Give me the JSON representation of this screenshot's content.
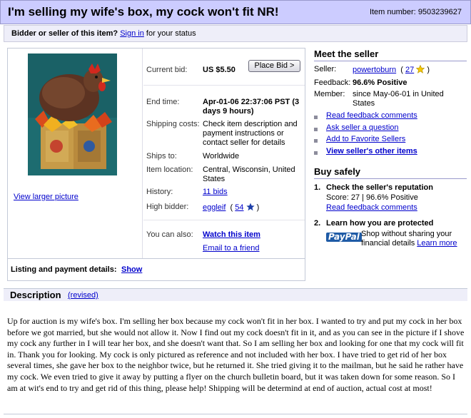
{
  "title": "I'm selling my wife's box, my cock won't fit NR!",
  "item_number_label": "Item number:",
  "item_number": "9503239627",
  "status": {
    "question": "Bidder or seller of this item?",
    "sign_in": "Sign in",
    "suffix": "for your status"
  },
  "view_larger": "View larger picture",
  "details": {
    "current_bid_label": "Current bid:",
    "current_bid": "US $5.50",
    "place_bid": "Place Bid >",
    "end_time_label": "End time:",
    "end_time": "Apr-01-06 22:37:06 PST (3 days 9 hours)",
    "shipping_label": "Shipping costs:",
    "shipping": "Check item description and payment instructions or contact seller for details",
    "ships_to_label": "Ships to:",
    "ships_to": "Worldwide",
    "location_label": "Item location:",
    "location": "Central, Wisconsin, United States",
    "history_label": "History:",
    "history": "11 bids",
    "high_bidder_label": "High bidder:",
    "high_bidder": "eggleif",
    "high_bidder_score": "54",
    "you_can_also_label": "You can also:",
    "watch": "Watch this item",
    "email": "Email to a friend"
  },
  "listing": {
    "label": "Listing and payment details:",
    "show": "Show"
  },
  "seller": {
    "heading": "Meet the seller",
    "seller_label": "Seller:",
    "seller_name": "powertoburn",
    "seller_score": "27",
    "feedback_label": "Feedback:",
    "feedback": "96.6% Positive",
    "member_label": "Member:",
    "member": "since May-06-01 in United States",
    "links": [
      "Read feedback comments",
      "Ask seller a question",
      "Add to Favorite Sellers",
      "View seller's other items"
    ]
  },
  "safety": {
    "heading": "Buy safely",
    "step1_num": "1.",
    "step1_title": "Check the seller's reputation",
    "step1_score": "Score: 27 | 96.6% Positive",
    "step1_link": "Read feedback comments",
    "step2_num": "2.",
    "step2_title": "Learn how you are protected",
    "paypal_logo": "PayPal",
    "paypal_text": "Shop without sharing your financial details",
    "learn_more": "Learn more"
  },
  "description": {
    "heading": "Description",
    "revised": "(revised)",
    "body": "Up for auction is my wife's box. I'm selling her box because my cock won't fit in her box. I wanted to try and put my cock in her box before we got married, but she would not allow it. Now I find out my cock doesn't fit in it, and as you can see in the picture if I shove my cock any further in I will tear her box, and she doesn't want that. So I am selling her box and looking for one that my cock will fit in. Thank you for looking. My cock is only pictured as reference and not included with her box. I have tried to get rid of her box several times, she gave her box to the neighbor twice, but he returned it. She tried giving it to the mailman, but he said he rather have my cock. We even tried to give it away by putting a flyer on the church bulletin board, but it was taken down for some reason. So I am at wit's end to try and get rid of this thing, please help! Shipping will be determind at end of auction, actual cost at most!"
  },
  "colors": {
    "title_bar": "#ccccff",
    "link": "#0000cc",
    "panel_bg": "#eeeef9"
  },
  "icons": {
    "yellow_star": "yellow-star-icon",
    "blue_star": "blue-star-icon"
  }
}
